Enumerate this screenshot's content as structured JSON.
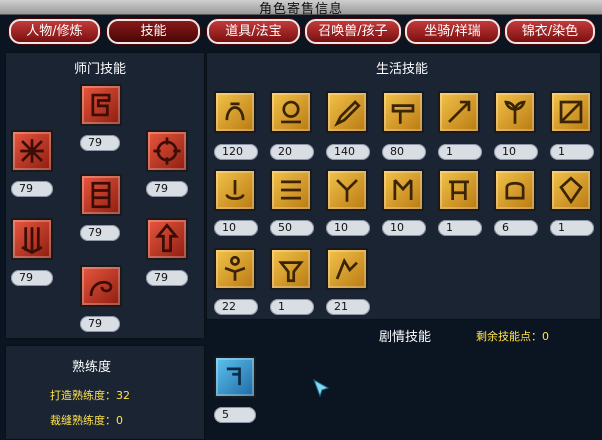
{
  "window": {
    "title": "角色寄售信息"
  },
  "tabs": [
    {
      "label": "人物/修炼"
    },
    {
      "label": "技能"
    },
    {
      "label": "道具/法宝"
    },
    {
      "label": "召唤兽/孩子"
    },
    {
      "label": "坐骑/祥瑞"
    },
    {
      "label": "锦衣/染色"
    }
  ],
  "school_skills": {
    "title": "师门技能",
    "items": [
      {
        "icon": "school-skill-1",
        "level": "79"
      },
      {
        "icon": "school-skill-2",
        "level": "79"
      },
      {
        "icon": "school-skill-3",
        "level": "79"
      },
      {
        "icon": "school-skill-4",
        "level": "79"
      },
      {
        "icon": "school-skill-5",
        "level": "79"
      },
      {
        "icon": "school-skill-6",
        "level": "79"
      },
      {
        "icon": "school-skill-7",
        "level": "79"
      }
    ]
  },
  "life_skills": {
    "title": "生活技能",
    "items": [
      {
        "icon": "life-skill-1",
        "level": "120"
      },
      {
        "icon": "life-skill-2",
        "level": "20"
      },
      {
        "icon": "life-skill-3",
        "level": "140"
      },
      {
        "icon": "life-skill-4",
        "level": "80"
      },
      {
        "icon": "life-skill-5",
        "level": "1"
      },
      {
        "icon": "life-skill-6",
        "level": "10"
      },
      {
        "icon": "life-skill-7",
        "level": "1"
      },
      {
        "icon": "life-skill-8",
        "level": "10"
      },
      {
        "icon": "life-skill-9",
        "level": "50"
      },
      {
        "icon": "life-skill-10",
        "level": "10"
      },
      {
        "icon": "life-skill-11",
        "level": "10"
      },
      {
        "icon": "life-skill-12",
        "level": "1"
      },
      {
        "icon": "life-skill-13",
        "level": "6"
      },
      {
        "icon": "life-skill-14",
        "level": "1"
      },
      {
        "icon": "life-skill-15",
        "level": "22"
      },
      {
        "icon": "life-skill-16",
        "level": "1"
      },
      {
        "icon": "life-skill-17",
        "level": "21"
      }
    ]
  },
  "proficiency": {
    "title": "熟练度",
    "forging_label": "打造熟练度：",
    "forging_value": "32",
    "tailoring_label": "裁缝熟练度：",
    "tailoring_value": "0"
  },
  "story_skills": {
    "title": "剧情技能",
    "remaining_label": "剩余技能点：",
    "remaining_value": "0",
    "items": [
      {
        "icon": "story-skill-1",
        "level": "5"
      }
    ]
  },
  "colors": {
    "tab_red": "#a82020",
    "panel": "#1a2433",
    "background": "#0b1522",
    "gold_icon": "#e0a030",
    "red_icon": "#c8402e",
    "blue_icon": "#3aa0d8",
    "highlight_text": "#ffe34a"
  }
}
